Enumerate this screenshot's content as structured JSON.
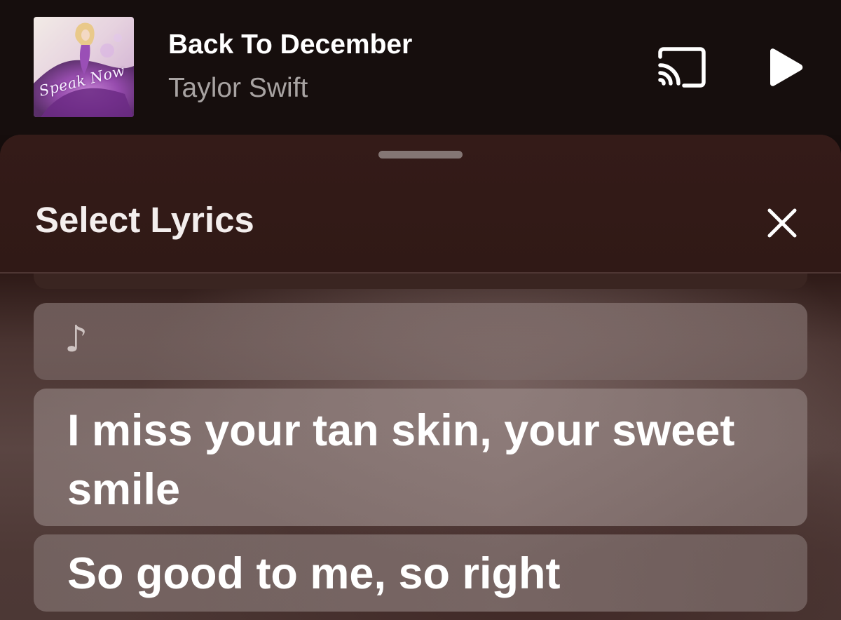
{
  "now_playing": {
    "title": "Back To December",
    "artist": "Taylor Swift",
    "album_art": {
      "script_text": "Speak Now",
      "palette": [
        "#3d1d4a",
        "#8a4aa6",
        "#d9a7e3",
        "#f5e6d8"
      ]
    },
    "cast_icon": "cast-icon",
    "play_icon": "play-icon"
  },
  "sheet": {
    "title": "Select Lyrics",
    "close_icon": "close-icon"
  },
  "lyrics": [
    {
      "text": "♪",
      "kind": "instrumental-break"
    },
    {
      "text": "I miss your tan skin, your sweet smile",
      "kind": "lyric"
    },
    {
      "text": "So good to me, so right",
      "kind": "lyric"
    }
  ],
  "colors": {
    "background": "#160e0d",
    "sheet": "#341b18",
    "title_text": "#ffffff",
    "artist_text": "#a8a3a2"
  }
}
